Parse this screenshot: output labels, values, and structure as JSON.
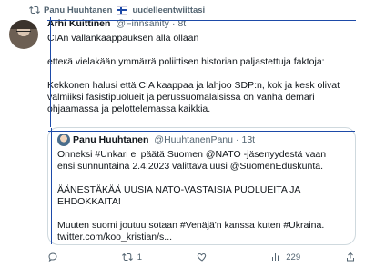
{
  "retweet": {
    "retweeter": "Panu Huuhtanen",
    "suffix": "uudelleentwiittasi"
  },
  "tweet": {
    "author_name": "Arhi Kuittinen",
    "author_handle": "@Finnsanity",
    "time": "8t",
    "paragraphs": [
      "CIAn vallankaappauksen alla ollaan",
      "etteкä vielakään ymmärrä poliittisen historian paljastettuja faktoja:",
      "Kekkonen halusi että CIA kaappaa ja lahjoo SDP:n, kok ja kesk olivat valmiiksi fasistipuolueit ja perussuomalaisissa on vanha demari ohjaamassa ja pelottelemassa kaikkia."
    ]
  },
  "quote": {
    "author_name": "Panu Huuhtanen",
    "author_handle": "@HuuhtanenPanu",
    "time": "13t",
    "paragraphs": [
      "Onneksi #Unkari ei päätä Suomen @NATO -jäsenyydestä vaan ensi sunnuntaina 2.4.2023 valittava uusi @SuomenEduskunta.",
      "ÄÄNESTÄKÄÄ UUSIA NATO-VASTAISIA PUOLUEITA JA EHDOKKAITA!",
      "Muuten suomi joutuu sotaan #Venäjä'n kanssa kuten #Ukraina. twitter.com/koo_kristian/s..."
    ]
  },
  "actions": {
    "reply_count": "",
    "retweet_count": "1",
    "like_count": "",
    "views_count": "229"
  },
  "icons": {
    "retweet": "retweet-icon",
    "reply": "reply-icon",
    "like": "heart-icon",
    "views": "views-icon",
    "share": "share-icon"
  }
}
